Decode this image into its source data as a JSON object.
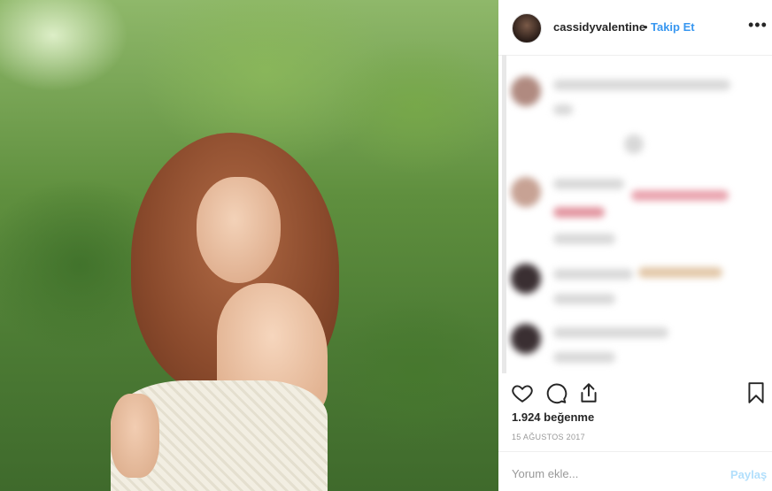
{
  "post": {
    "username": "cassidyvalentine",
    "separator": "•",
    "follow_label": "Takip Et",
    "more_label": "•••",
    "likes_text": "1.924 beğenme",
    "date_text": "15 AĞUSTOS 2017",
    "comment_placeholder": "Yorum ekle...",
    "share_label": "Paylaş"
  },
  "colors": {
    "link": "#3897f0",
    "share_disabled": "#b2dffc",
    "text": "#262626",
    "muted": "#999999"
  },
  "icons": {
    "like": "heart-icon",
    "comment": "comment-icon",
    "share": "share-icon",
    "save": "bookmark-icon"
  }
}
